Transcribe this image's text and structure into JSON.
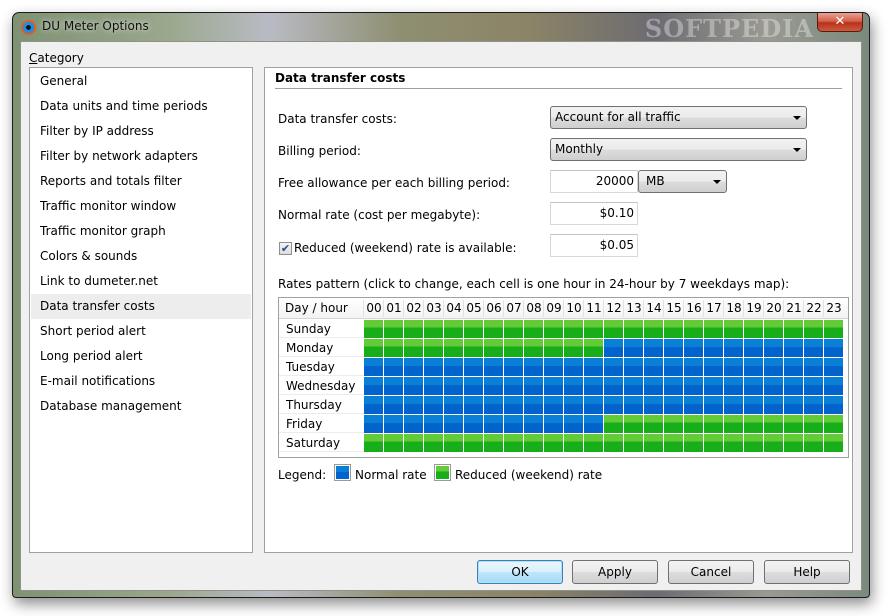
{
  "window": {
    "title": "DU Meter Options",
    "watermark": "SOFTPEDIA",
    "close_glyph": "✕"
  },
  "sidebar": {
    "label": "Category",
    "label_accesskey": "C",
    "label_rest": "ategory",
    "selected_index": 9,
    "items": [
      {
        "label": "General"
      },
      {
        "label": "Data units and time periods"
      },
      {
        "label": "Filter by IP address"
      },
      {
        "label": "Filter by network adapters"
      },
      {
        "label": "Reports and totals filter"
      },
      {
        "label": "Traffic monitor window"
      },
      {
        "label": "Traffic monitor graph"
      },
      {
        "label": "Colors & sounds"
      },
      {
        "label": "Link to dumeter.net"
      },
      {
        "label": "Data transfer costs"
      },
      {
        "label": "Short period alert"
      },
      {
        "label": "Long period alert"
      },
      {
        "label": "E-mail notifications"
      },
      {
        "label": "Database management"
      }
    ]
  },
  "panel": {
    "title": "Data transfer costs",
    "data_transfer_costs": {
      "label": "Data transfer costs:",
      "value": "Account for all traffic"
    },
    "billing_period": {
      "label": "Billing period:",
      "value": "Monthly"
    },
    "free_allowance": {
      "label": "Free allowance per each billing period:",
      "value": "20000",
      "unit": "MB"
    },
    "normal_rate": {
      "label": "Normal rate (cost per megabyte):",
      "value": "$0.10"
    },
    "reduced_rate": {
      "label": "Reduced (weekend) rate is available:",
      "checked": true,
      "check_glyph": "✔",
      "value": "$0.05"
    },
    "pattern_label": "Rates pattern (click to change, each cell is one hour in 24-hour by 7 weekdays map):",
    "grid": {
      "corner_label": "Day / hour",
      "hours": [
        "00",
        "01",
        "02",
        "03",
        "04",
        "05",
        "06",
        "07",
        "08",
        "09",
        "10",
        "11",
        "12",
        "13",
        "14",
        "15",
        "16",
        "17",
        "18",
        "19",
        "20",
        "21",
        "22",
        "23"
      ],
      "days": [
        {
          "name": "Sunday",
          "pattern": "RRRRRRRRRRRRRRRRRRRRRRRR"
        },
        {
          "name": "Monday",
          "pattern": "RRRRRRRRRRRRNNNNNNNNNNNN"
        },
        {
          "name": "Tuesday",
          "pattern": "NNNNNNNNNNNNNNNNNNNNNNNN"
        },
        {
          "name": "Wednesday",
          "pattern": "NNNNNNNNNNNNNNNNNNNNNNNN"
        },
        {
          "name": "Thursday",
          "pattern": "NNNNNNNNNNNNNNNNNNNNNNNN"
        },
        {
          "name": "Friday",
          "pattern": "NNNNNNNNNNNNRRRRRRRRRRRR"
        },
        {
          "name": "Saturday",
          "pattern": "RRRRRRRRRRRRRRRRRRRRRRRR"
        }
      ],
      "pattern_key": {
        "N": "normal",
        "R": "reduced"
      }
    },
    "legend": {
      "label": "Legend:",
      "normal": "Normal rate",
      "reduced": "Reduced (weekend) rate",
      "normal_color": "#0a7fd6",
      "reduced_color": "#18ae1a"
    }
  },
  "buttons": {
    "ok": "OK",
    "apply": "Apply",
    "cancel": "Cancel",
    "help": "Help"
  }
}
